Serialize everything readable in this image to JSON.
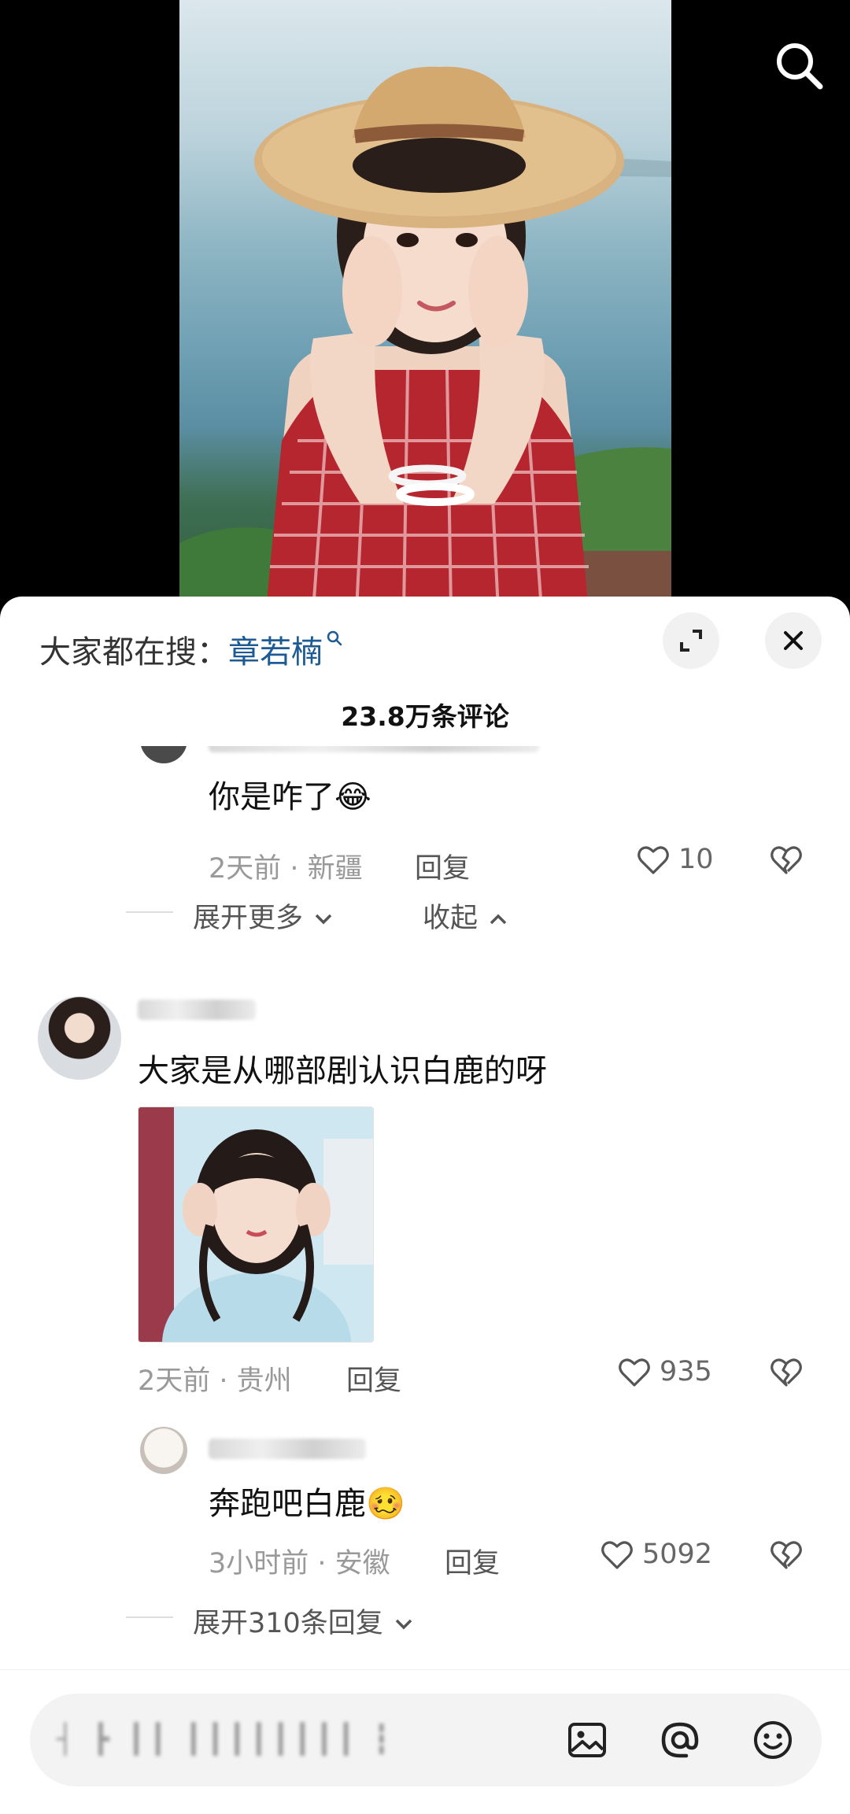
{
  "hot_search": {
    "prefix": "大家都在搜：",
    "keyword": "章若楠"
  },
  "comment_count": "23.8万条评论",
  "comments": [
    {
      "text": "你是咋了",
      "emoji": "😂",
      "meta": "2天前 · 新疆",
      "reply_label": "回复",
      "likes": "10"
    },
    {
      "expand_more": "展开更多",
      "collapse": "收起"
    },
    {
      "text": "大家是从哪部剧认识白鹿的呀",
      "meta": "2天前 · 贵州",
      "reply_label": "回复",
      "likes": "935"
    },
    {
      "text": "奔跑吧白鹿",
      "emoji": "🥴",
      "meta": "3小时前 · 安徽",
      "reply_label": "回复",
      "likes": "5092",
      "expand_replies": "展开310条回复"
    }
  ],
  "input": {
    "placeholder": "┤ ┣ ┃┃ ┃┃┃┃┃┃┃┃ ┇"
  },
  "icons": {
    "search": "search-icon",
    "expand": "expand-icon",
    "close": "close-icon",
    "like": "heart-icon",
    "dislike": "broken-heart-icon",
    "image": "image-icon",
    "mention": "at-icon",
    "emoji": "emoji-icon"
  },
  "colors": {
    "keyword": "#1e5a93",
    "sheet_bg": "#ffffff",
    "video_bg": "#000000"
  }
}
